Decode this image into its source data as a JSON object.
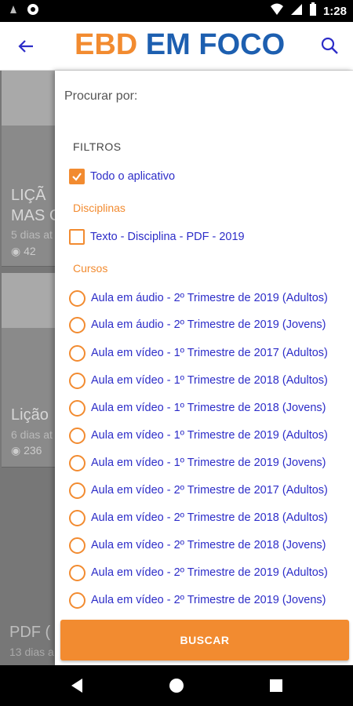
{
  "status_bar": {
    "time": "1:28"
  },
  "app_bar": {
    "logo_part1": "EBD",
    "logo_part2": "EM FOCO"
  },
  "background": {
    "cards": [
      {
        "title": "LIÇÃ",
        "title2": "MAS C",
        "meta": "5 dias at",
        "views": "42"
      },
      {
        "title": "Lição",
        "meta": "6 dias at",
        "views": "236"
      }
    ],
    "bottom": {
      "title": "PDF (",
      "meta": "13 dias a"
    }
  },
  "drawer": {
    "search_label": "Procurar por:",
    "filters_title": "FILTROS",
    "all_app": {
      "label": "Todo o aplicativo",
      "checked": true
    },
    "disciplinas_title": "Disciplinas",
    "disciplinas": [
      {
        "label": "Texto - Disciplina - PDF - 2019",
        "checked": false
      }
    ],
    "cursos_title": "Cursos",
    "cursos": [
      "Aula em áudio - 2º Trimestre de 2019 (Adultos)",
      "Aula em áudio - 2º Trimestre de 2019 (Jovens)",
      "Aula em vídeo - 1º Trimestre de 2017 (Adultos)",
      "Aula em vídeo - 1º Trimestre de 2018 (Adultos)",
      "Aula em vídeo - 1º Trimestre de 2018 (Jovens)",
      "Aula em vídeo - 1º Trimestre de 2019 (Adultos)",
      "Aula em vídeo - 1º Trimestre de 2019 (Jovens)",
      "Aula em vídeo - 2º Trimestre de 2017 (Adultos)",
      "Aula em vídeo - 2º Trimestre de 2018 (Adultos)",
      "Aula em vídeo - 2º Trimestre de 2018 (Jovens)",
      "Aula em vídeo - 2º Trimestre de 2019 (Adultos)",
      "Aula em vídeo - 2º Trimestre de 2019 (Jovens)"
    ],
    "buscar_label": "BUSCAR"
  },
  "colors": {
    "accent": "#f28b30",
    "brand_blue": "#1d5fb0",
    "link": "#2d2dc8"
  }
}
